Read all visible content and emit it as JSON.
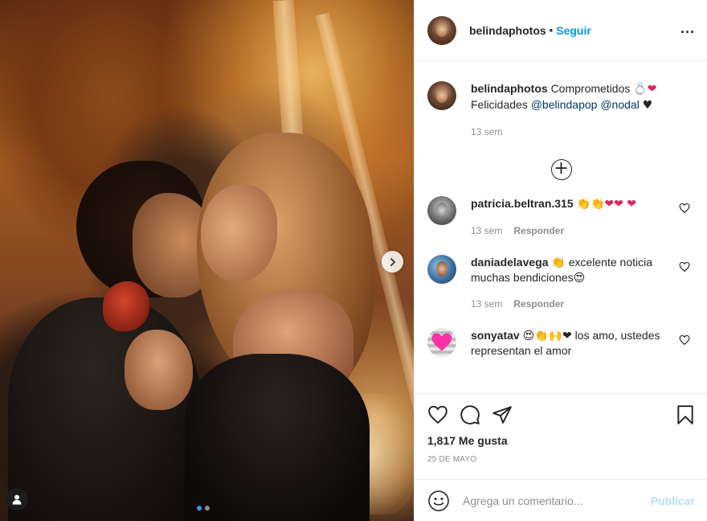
{
  "photo": {
    "alt_icons": [
      "chevron-right-icon",
      "person-tag-icon"
    ],
    "carousel": {
      "count": 2,
      "active": 0
    }
  },
  "header": {
    "username": "belindaphotos",
    "separator": "•",
    "follow_label": "Seguir",
    "more_label": "..."
  },
  "caption": {
    "username": "belindaphotos",
    "text": "Comprometidos",
    "emojis": "💍❤",
    "line2_prefix": "Felicidades",
    "mention1": "@belindapop",
    "mention2": "@nodal",
    "line2_suffix": "♥",
    "time": "13 sem"
  },
  "load_more_label": "+",
  "comments": [
    {
      "username": "patricia.beltran.315",
      "text": "👏👏❤❤ ❤",
      "time": "13 sem",
      "reply_label": "Responder"
    },
    {
      "username": "daniadelavega",
      "text": "👏 excelente noticia muchas bendiciones😍",
      "time": "13 sem",
      "reply_label": "Responder"
    },
    {
      "username": "sonyatav",
      "text": "😍👏🙌❤ los amo, ustedes representan el amor"
    }
  ],
  "likes": {
    "count_text": "1,817 Me gusta"
  },
  "date": "25 DE MAYO",
  "add_comment": {
    "placeholder": "Agrega un comentario...",
    "publish_label": "Publicar"
  },
  "colors": {
    "follow": "#0095f6",
    "publish_disabled": "#b2dffc",
    "carousel_active": "#3897f0",
    "meta_gray": "#8e8e8e"
  }
}
